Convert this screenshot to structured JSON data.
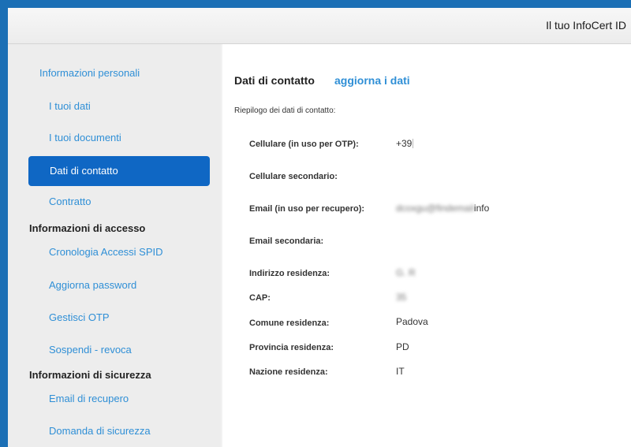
{
  "header": {
    "brand": "Il tuo InfoCert ID"
  },
  "sidebar": {
    "items": [
      {
        "label": "Informazioni personali"
      },
      {
        "label": "I tuoi dati"
      },
      {
        "label": "I tuoi documenti"
      },
      {
        "label": "Dati di contatto",
        "active": true
      },
      {
        "label": "Contratto"
      },
      {
        "label": "Cronologia Accessi SPID"
      },
      {
        "label": "Aggiorna password"
      },
      {
        "label": "Gestisci OTP"
      },
      {
        "label": "Sospendi - revoca"
      },
      {
        "label": "Email di recupero"
      },
      {
        "label": "Domanda di sicurezza"
      }
    ],
    "sections": [
      {
        "label": "Informazioni di accesso"
      },
      {
        "label": "Informazioni di sicurezza"
      }
    ]
  },
  "main": {
    "title": "Dati di contatto",
    "update_link": "aggiorna i dati",
    "summary": "Riepilogo dei dati di contatto:",
    "rows": [
      {
        "label": "Cellulare (in uso per OTP):",
        "value": "+39"
      },
      {
        "label": "Cellulare secondario:",
        "value": ""
      },
      {
        "label": "Email (in uso per recupero):",
        "value": "info"
      },
      {
        "label": "Email secondaria:",
        "value": ""
      },
      {
        "label": "Indirizzo residenza:",
        "value": ""
      },
      {
        "label": "CAP:",
        "value": ""
      },
      {
        "label": "Comune residenza:",
        "value": "Padova"
      },
      {
        "label": "Provincia residenza:",
        "value": "PD"
      },
      {
        "label": "Nazione residenza:",
        "value": "IT"
      }
    ]
  }
}
